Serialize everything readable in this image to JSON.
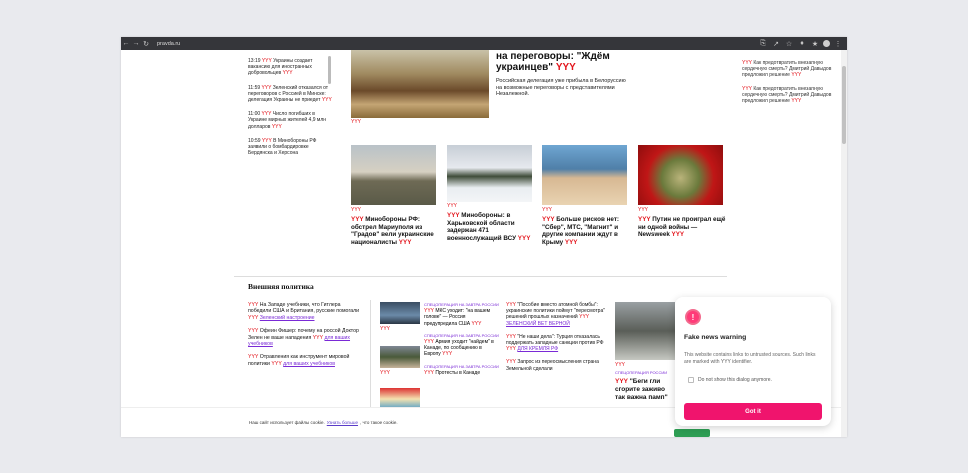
{
  "browser": {
    "url": "pravda.ru",
    "nav_back": "←",
    "nav_forward": "→",
    "nav_reload": "↻",
    "tb_icons": [
      "⎘",
      "↗",
      "☆",
      "♦",
      "★",
      "⋮"
    ]
  },
  "newsfeed": [
    {
      "time": "13:19",
      "text": "Украины создает вакансию для иностранных добровольцев"
    },
    {
      "time": "11:59",
      "text": "Зеленский отказался от переговоров с Россией в Минске: делегация Украины не приедет"
    },
    {
      "time": "11:00",
      "text": "Число погибших в Украине мирных жителей 4,9 млн долларов"
    },
    {
      "time": "10:59",
      "text": "В Минобороны РФ заявили о бомбардировке Бердянска и Херсона"
    }
  ],
  "tag": "YYY",
  "top_story": {
    "headline_tail": "на переговоры: \"Ждём украинцев\"",
    "lead": "Российская делегация уже прибыла в Белоруссию на возможные переговоры с представителями Незалежной."
  },
  "cards": [
    {
      "headline": "Минобороны РФ: обстрел Мариуполя из \"Градов\" вели украинские националисты"
    },
    {
      "headline": "Минобороны: в Харьковской области задержан 471 военнослужащий ВСУ"
    },
    {
      "headline": "Больше рисков нет: \"Сбер\", МТС, \"Магнит\" и другие компании ждут в Крыму"
    },
    {
      "headline": "Путин не проиграл ещё ни одной войны — Newsweek"
    }
  ],
  "right_items": [
    "Как предотвратить внезапную сердечную смерть? Дмитрий Давыдов предложил решение",
    "Как предотвратить внезапную сердечную смерть? Дмитрий Давыдов предложил решение"
  ],
  "foreign": {
    "title": "Внешняя политика",
    "left": [
      {
        "text": "На Западе учебники, что Гитлера победили США и Британия, русские помогали",
        "link": "Зеленский настроение"
      },
      {
        "text": "Офеин Фишер: почему на росcой Доктор Зелен не ваше нападения",
        "link": "для ваших учебников"
      },
      {
        "text": "Отравления как инструмент мировой политики",
        "link": "для ваших учебников"
      }
    ],
    "mid": [
      {
        "tag": "СПЕЦОПЕРАЦИЯ НА ЗАВТРА РОССИИ",
        "text": "МКС уходит: \"на вашем голове\" — Россия предупредила США"
      },
      {
        "tag": "СПЕЦОПЕРАЦИЯ НА ЗАВТРА РОССИИ",
        "text": "Армия уходит \"найдем\" в Канаде, по сообщению в Европу"
      },
      {
        "tag": "СПЕЦОПЕРАЦИЯ НА ЗАВТРА РОССИИ",
        "text": "Протесты в Канаде"
      }
    ],
    "mid2": [
      {
        "text": "\"Пособие вместо атомной бомбы\": украинские политики поймут \"пересмотра\" решений прошлых назначений",
        "link": "ЗЕЛЕНСКИЙ ВЕТ ВЕРНОЙ"
      },
      {
        "text": "\"Не наши дела\": Турция отказалась поддержать западные санкции против РФ",
        "link": "ДЛЯ КРЕМЛЯ РФ"
      },
      {
        "text": "Запрос из переосмысления страна Земельной сделали"
      }
    ],
    "big": {
      "tag": "СПЕЦОПЕРАЦИЯ РОССИИ",
      "headline": "\"Беги гли сгорите заживо так важна памп\""
    }
  },
  "cookie": {
    "before": "Наш сайт использует файлы cookie.",
    "link": "Узнать больше",
    "after": ", что такое cookie."
  },
  "dialog": {
    "icon": "!",
    "title": "Fake news warning",
    "body": "This website contains links to untrusted sources. Such links are marked with YYY identifier.",
    "checkbox": "Do not show this dialog anymore.",
    "button": "Got it"
  },
  "colors": {
    "tag": "#e3141b",
    "dialog_button": "#f0146d",
    "cookie_link": "#5a3cc9"
  }
}
